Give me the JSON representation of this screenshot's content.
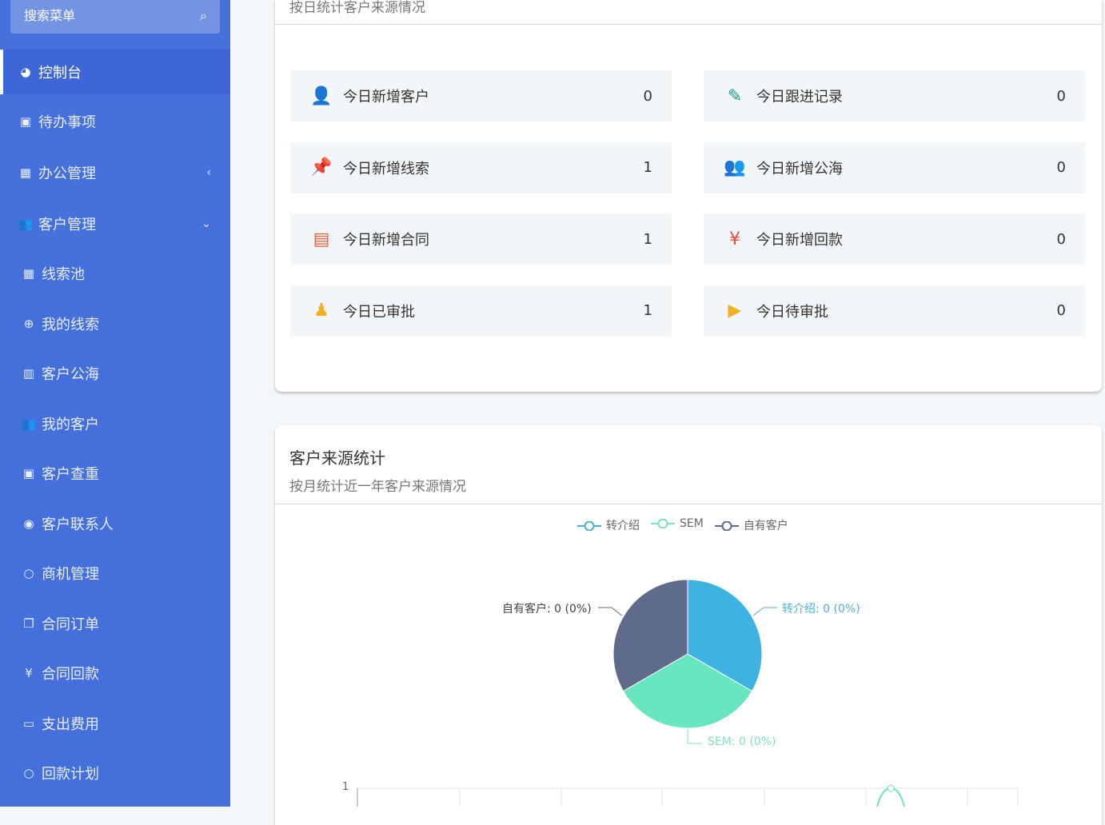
{
  "sidebar": {
    "search_placeholder": "搜索菜单",
    "items": [
      {
        "label": "控制台",
        "icon": "dashboard-icon",
        "glyph": "◕"
      },
      {
        "label": "待办事项",
        "icon": "calendar-check-icon",
        "glyph": "▣"
      },
      {
        "label": "办公管理",
        "icon": "windows-icon",
        "glyph": "▦",
        "arrow": "‹"
      },
      {
        "label": "客户管理",
        "icon": "users-icon",
        "glyph": "👥",
        "arrow": "⌄"
      },
      {
        "label": "线索池",
        "icon": "grid-icon",
        "glyph": "▦"
      },
      {
        "label": "我的线索",
        "icon": "search-plus-icon",
        "glyph": "⊕"
      },
      {
        "label": "客户公海",
        "icon": "map-icon",
        "glyph": "▥"
      },
      {
        "label": "我的客户",
        "icon": "users-icon",
        "glyph": "👥"
      },
      {
        "label": "客户查重",
        "icon": "contact-card-icon",
        "glyph": "▣"
      },
      {
        "label": "客户联系人",
        "icon": "user-circle-icon",
        "glyph": "◉"
      },
      {
        "label": "商机管理",
        "icon": "circle-icon",
        "glyph": "○"
      },
      {
        "label": "合同订单",
        "icon": "copy-icon",
        "glyph": "❐"
      },
      {
        "label": "合同回款",
        "icon": "yen-icon",
        "glyph": "¥"
      },
      {
        "label": "支出费用",
        "icon": "money-icon",
        "glyph": "▭"
      },
      {
        "label": "回款计划",
        "icon": "circle-icon",
        "glyph": "○"
      }
    ]
  },
  "card1": {
    "subtitle": "按日统计客户来源情况",
    "stats": [
      {
        "label": "今日新增客户",
        "value": "0",
        "icon": "customer-icon",
        "color": "#1a9e8a"
      },
      {
        "label": "今日跟进记录",
        "value": "0",
        "icon": "edit-record-icon",
        "color": "#1a9e8a"
      },
      {
        "label": "今日新增线索",
        "value": "1",
        "icon": "pin-icon",
        "color": "#1a9e8a"
      },
      {
        "label": "今日新增公海",
        "value": "0",
        "icon": "public-pool-icon",
        "color": "#1a9e8a"
      },
      {
        "label": "今日新增合同",
        "value": "1",
        "icon": "contract-icon",
        "color": "#ef5a3c"
      },
      {
        "label": "今日新增回款",
        "value": "0",
        "icon": "wallet-yen-icon",
        "color": "#e84c3d"
      },
      {
        "label": "今日已审批",
        "value": "1",
        "icon": "stamp-icon",
        "color": "#f0b020"
      },
      {
        "label": "今日待审批",
        "value": "0",
        "icon": "presentation-icon",
        "color": "#f0b020"
      }
    ]
  },
  "card2": {
    "title": "客户来源统计",
    "subtitle": "按月统计近一年客户来源情况"
  },
  "chart_data": [
    {
      "type": "pie",
      "legend": [
        "转介绍",
        "SEM",
        "自有客户"
      ],
      "legend_placement": "top",
      "slices": [
        {
          "name": "转介绍",
          "value": 0,
          "label": "转介绍: 0 (0%)",
          "color": "#3eb2e0"
        },
        {
          "name": "SEM",
          "value": 0,
          "label": "SEM: 0 (0%)",
          "color": "#68e6c0"
        },
        {
          "name": "自有客户",
          "value": 0,
          "label": "自有客户: 0 (0%)",
          "color": "#5f6b8a"
        }
      ]
    },
    {
      "type": "line",
      "y_tick_labels": [
        "1"
      ],
      "grid": true
    }
  ]
}
